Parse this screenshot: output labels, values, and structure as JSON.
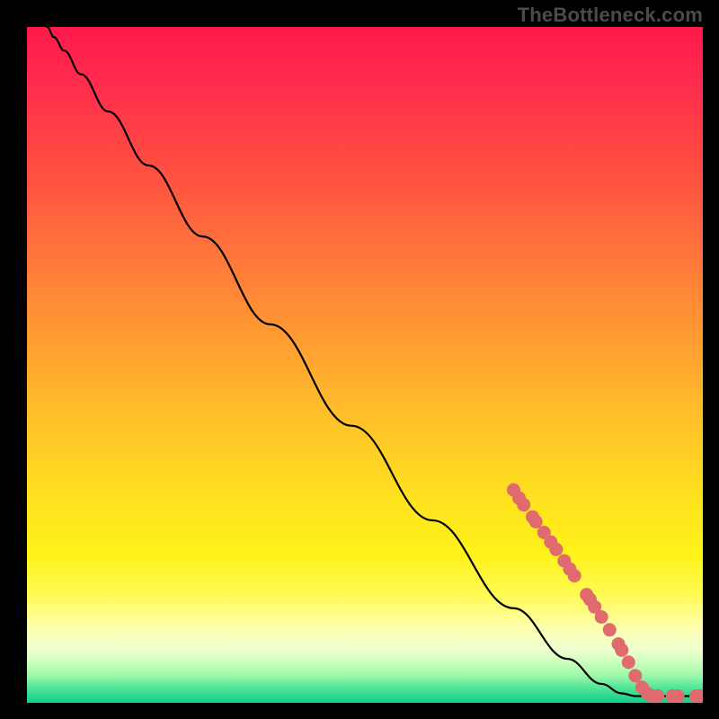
{
  "watermark": "TheBottleneck.com",
  "chart_data": {
    "type": "line",
    "title": "",
    "xlabel": "",
    "ylabel": "",
    "xlim": [
      0,
      100
    ],
    "ylim": [
      0,
      100
    ],
    "curve": [
      {
        "x": 3.0,
        "y": 100.0
      },
      {
        "x": 4.0,
        "y": 98.5
      },
      {
        "x": 5.5,
        "y": 96.5
      },
      {
        "x": 8.0,
        "y": 93.0
      },
      {
        "x": 12.0,
        "y": 87.5
      },
      {
        "x": 18.0,
        "y": 79.5
      },
      {
        "x": 26.0,
        "y": 69.0
      },
      {
        "x": 36.0,
        "y": 56.0
      },
      {
        "x": 48.0,
        "y": 41.0
      },
      {
        "x": 60.0,
        "y": 27.0
      },
      {
        "x": 72.0,
        "y": 14.0
      },
      {
        "x": 80.0,
        "y": 6.5
      },
      {
        "x": 85.0,
        "y": 2.8
      },
      {
        "x": 88.0,
        "y": 1.4
      },
      {
        "x": 90.0,
        "y": 1.0
      },
      {
        "x": 100.0,
        "y": 1.0
      }
    ],
    "series": [
      {
        "name": "highlighted-points",
        "color": "#e06a6d",
        "points": [
          {
            "x": 72.0,
            "y": 31.5
          },
          {
            "x": 72.8,
            "y": 30.3
          },
          {
            "x": 73.5,
            "y": 29.3
          },
          {
            "x": 74.8,
            "y": 27.5
          },
          {
            "x": 75.3,
            "y": 26.8
          },
          {
            "x": 76.5,
            "y": 25.2
          },
          {
            "x": 77.5,
            "y": 23.8
          },
          {
            "x": 78.3,
            "y": 22.7
          },
          {
            "x": 79.5,
            "y": 21.0
          },
          {
            "x": 80.3,
            "y": 19.8
          },
          {
            "x": 81.0,
            "y": 18.8
          },
          {
            "x": 82.8,
            "y": 16.0
          },
          {
            "x": 83.3,
            "y": 15.3
          },
          {
            "x": 84.0,
            "y": 14.2
          },
          {
            "x": 85.0,
            "y": 12.7
          },
          {
            "x": 86.2,
            "y": 10.8
          },
          {
            "x": 87.5,
            "y": 8.7
          },
          {
            "x": 88.0,
            "y": 7.8
          },
          {
            "x": 89.0,
            "y": 6.0
          },
          {
            "x": 90.0,
            "y": 4.0
          },
          {
            "x": 91.0,
            "y": 2.3
          },
          {
            "x": 91.8,
            "y": 1.4
          },
          {
            "x": 92.5,
            "y": 1.0
          },
          {
            "x": 93.3,
            "y": 1.0
          },
          {
            "x": 95.5,
            "y": 1.0
          },
          {
            "x": 96.3,
            "y": 1.0
          },
          {
            "x": 99.0,
            "y": 1.0
          },
          {
            "x": 99.7,
            "y": 1.0
          }
        ]
      }
    ]
  }
}
